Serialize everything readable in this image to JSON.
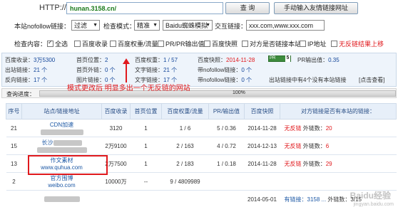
{
  "toolbar": {
    "http_label": "HTTP://",
    "url_value": "hunan.3158.cn/",
    "query_button": "查 询",
    "manual_button": "手动输入友情链接网址"
  },
  "options": {
    "nofollow_label": "本站nofollow链接：",
    "nofollow_value": "过滤",
    "mode_label": "检查模式：",
    "mode_value": "精准",
    "spider_value": "Baidu蜘蛛模拟",
    "exchange_label": "交互链接：",
    "exchange_value": "xxx.com,www.xxx.com"
  },
  "check": {
    "label": "检查内容：",
    "items": [
      {
        "label": "全选",
        "checked": true
      },
      {
        "label": "百度收录",
        "checked": false
      },
      {
        "label": "百度权重/流量",
        "checked": false
      },
      {
        "label": "PR/PR输出值",
        "checked": false
      },
      {
        "label": "百度快照",
        "checked": false
      },
      {
        "label": "对方是否链接本站",
        "checked": false
      },
      {
        "label": "IP地址",
        "checked": false
      },
      {
        "label": "无反链结果上移",
        "checked": false
      }
    ]
  },
  "stats": {
    "r1": {
      "l1": "百度收录：",
      "v1": "3万5300",
      "l2": "首页位置：",
      "v2": "2",
      "l3": "百度权重：",
      "v3": "1 / 57",
      "l4": "百度快照：",
      "v4": "2014-11-28",
      "badge": "PR",
      "badge_n": "5",
      "l5": "PR输出值：",
      "v5": "0.35"
    },
    "r2": {
      "l1": "出站链接：",
      "v1": "21 个",
      "l2": "首页外链：",
      "v2": "0 个",
      "l3": "文字链接：",
      "v3": "21 个",
      "l4": "带nofollow链接：",
      "v4": "0 个"
    },
    "r3": {
      "l1": "反向链接：",
      "v1": "17 个",
      "l2": "图片链接：",
      "v2": "0 个",
      "l3": "文字链接：",
      "v3": "17 个",
      "l4": "带nofollow链接：",
      "v4": "0 个",
      "l5": "出站链接中有4个没有本站链接",
      "l6": "[点击查看]"
    }
  },
  "progress": {
    "label": "查询进度：",
    "value": "100%"
  },
  "annotation": "模式更改后 明显多出一个无反链的网站",
  "table": {
    "headers": [
      "序号",
      "站点/链接地址",
      "百度收录",
      "首页位置",
      "百度权重/流量",
      "PR/输出值",
      "百度快照",
      "对方链接是否有本站的链接："
    ],
    "rows": [
      {
        "no": "21",
        "name": "CDN加速",
        "url": "",
        "idx": "3120",
        "pos": "1",
        "w": "1 / 6",
        "pr": "5 / 0.36",
        "snap": "2014-11-28",
        "res": "无反链",
        "out_label": "外链数：",
        "out": "20"
      },
      {
        "no": "15",
        "name": "长沙",
        "url": "",
        "idx": "2万9100",
        "pos": "1",
        "w": "2 / 163",
        "pr": "4 / 0.72",
        "snap": "2014-12-13",
        "res": "无反链",
        "out_label": "外链数：",
        "out": "6"
      },
      {
        "no": "13",
        "name": "作文素材",
        "url": "www.quhua.com",
        "idx": "2万7500",
        "pos": "1",
        "w": "2 / 183",
        "pr": "1 / 0.18",
        "snap": "2014-11-28",
        "res": "无反链",
        "out_label": "外链数：",
        "out": "29"
      },
      {
        "no": "2",
        "name": "官方围博",
        "url": "weibo.com",
        "idx": "10000万",
        "pos": "--",
        "w": "9 / 4809989",
        "pr": "",
        "snap": "",
        "res": "",
        "out_label": "",
        "out": ""
      },
      {
        "no": "",
        "name": "",
        "url": "",
        "idx": "",
        "pos": "",
        "w": "",
        "pr": "",
        "snap": "2014-05-01",
        "res": "有链接：3158 ...",
        "out_label": "外链数：",
        "out": "3/15"
      }
    ]
  },
  "watermark": "Baidu经验",
  "watermark_sub": "jingyan.baidu.com"
}
